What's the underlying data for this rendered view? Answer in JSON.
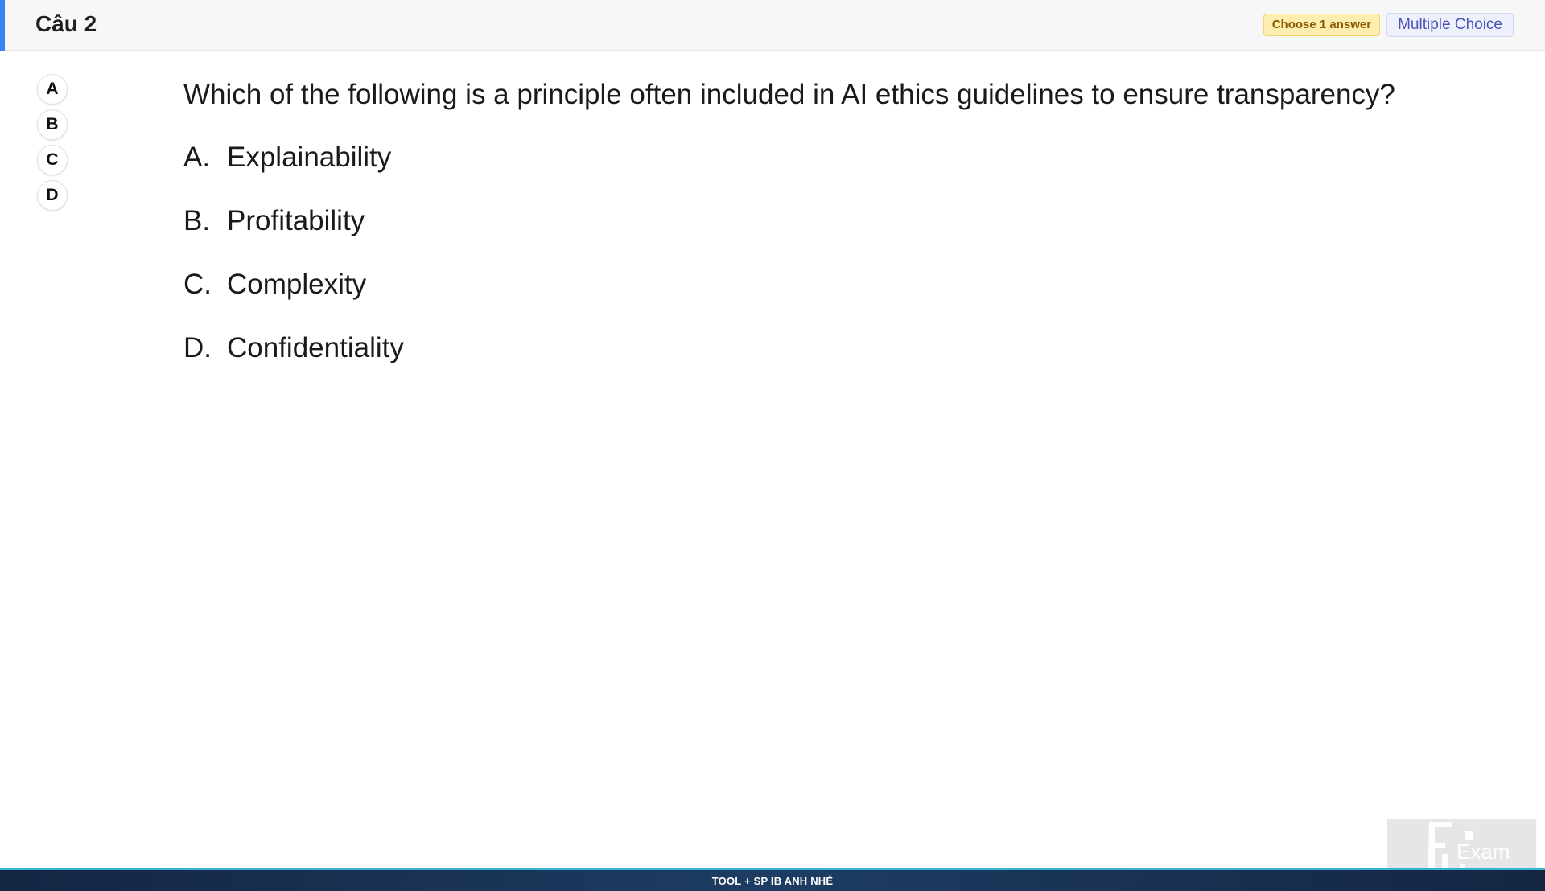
{
  "header": {
    "question_number": "Câu 2",
    "badge_choose": "Choose 1 answer",
    "badge_type": "Multiple Choice",
    "accent_color": "#3b82f6"
  },
  "answer_circles": [
    "A",
    "B",
    "C",
    "D"
  ],
  "question": {
    "text": "Which of the following is a principle often included in AI ethics guidelines to ensure transparency?",
    "options": [
      {
        "letter": "A.",
        "text": "Explainability"
      },
      {
        "letter": "B.",
        "text": "Profitability"
      },
      {
        "letter": "C.",
        "text": "Complexity"
      },
      {
        "letter": "D.",
        "text": "Confidentiality"
      }
    ]
  },
  "footer": {
    "text": "TOOL + SP IB ANH NHÉ"
  },
  "logo": {
    "text": "Exam",
    "icon": "fu-exam-logo-icon"
  }
}
